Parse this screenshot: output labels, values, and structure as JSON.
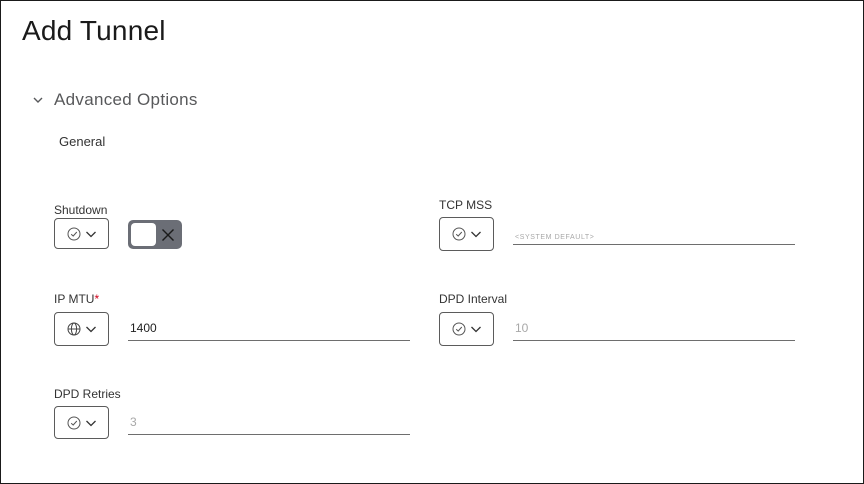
{
  "page": {
    "title": "Add Tunnel"
  },
  "section": {
    "label": "Advanced Options",
    "subsection": "General"
  },
  "fields": {
    "shutdown": {
      "label": "Shutdown",
      "scope_icon": "check-circle-icon",
      "toggle_state": "off"
    },
    "tcp_mss": {
      "label": "TCP MSS",
      "scope_icon": "check-circle-icon",
      "placeholder": "<SYSTEM DEFAULT>"
    },
    "ip_mtu": {
      "label": "IP MTU",
      "required_mark": "*",
      "scope_icon": "globe-icon",
      "value": "1400"
    },
    "dpd_interval": {
      "label": "DPD Interval",
      "scope_icon": "check-circle-icon",
      "placeholder": "10"
    },
    "dpd_retries": {
      "label": "DPD Retries",
      "scope_icon": "check-circle-icon",
      "placeholder": "3"
    }
  },
  "colors": {
    "toggle_bg": "#6b6e76",
    "required": "#d0021b",
    "border": "#5b5b5b"
  }
}
